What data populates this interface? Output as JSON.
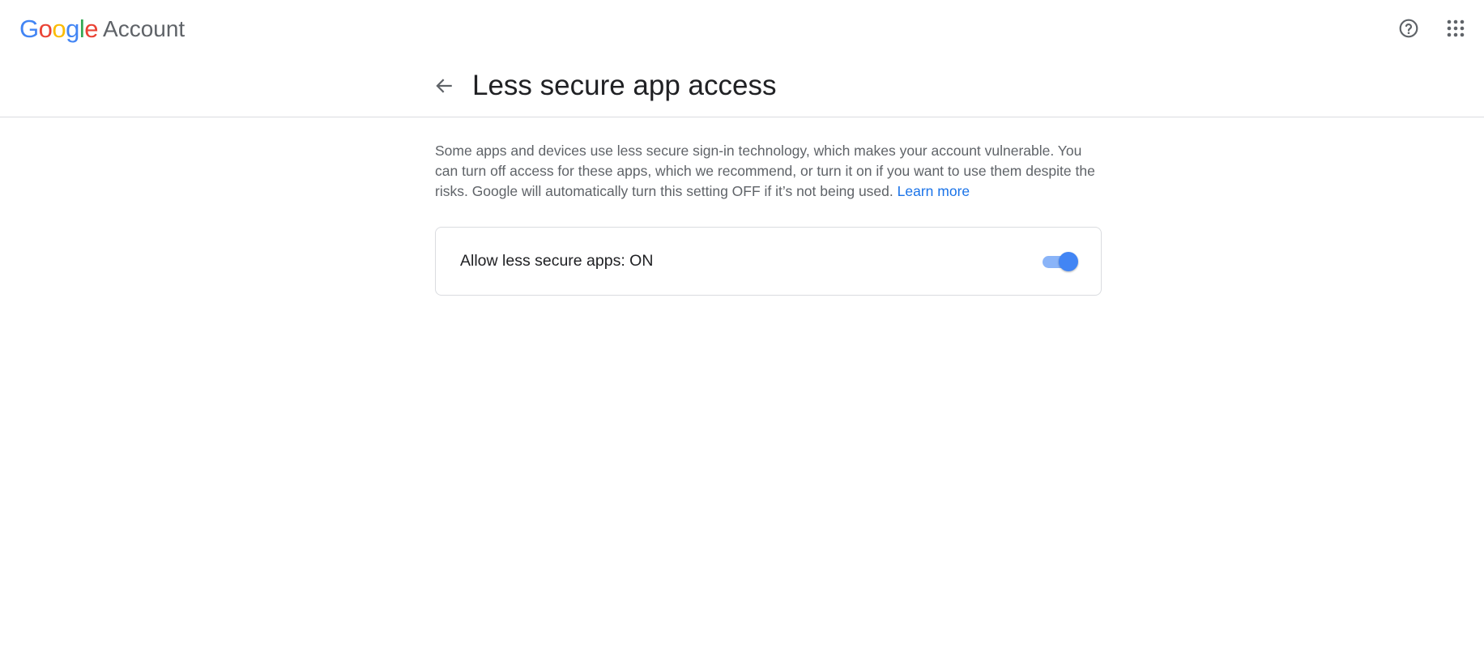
{
  "header": {
    "brand_word": "Google",
    "product_name": "Account",
    "help_icon": "help-circle-icon",
    "apps_icon": "apps-grid-icon"
  },
  "page": {
    "back_icon": "arrow-back-icon",
    "title": "Less secure app access",
    "description": "Some apps and devices use less secure sign-in technology, which makes your account vulnerable. You can turn off access for these apps, which we recommend, or turn it on if you want to use them despite the risks. Google will automatically turn this setting OFF if it’s not being used.",
    "learn_more": "Learn more"
  },
  "setting": {
    "label": "Allow less secure apps: ON",
    "enabled": true
  },
  "colors": {
    "link": "#1a73e8",
    "toggle_thumb": "#4285f4",
    "toggle_track": "#8ab4f8",
    "google_blue": "#4285f4",
    "google_red": "#ea4335",
    "google_yellow": "#fbbc05",
    "google_green": "#34a853"
  }
}
